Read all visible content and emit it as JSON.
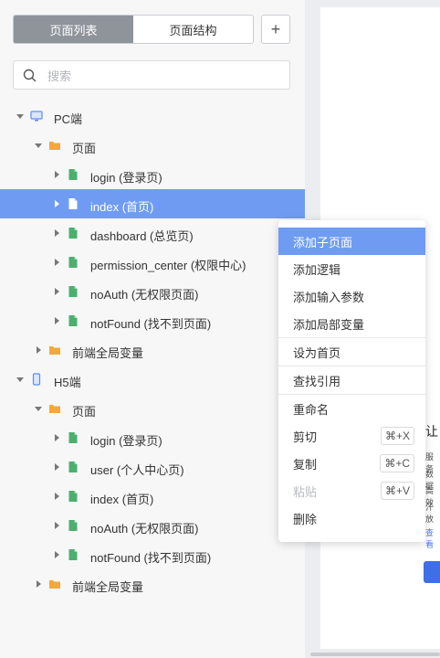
{
  "tabs": {
    "page_list": "页面列表",
    "page_structure": "页面结构"
  },
  "add_button": "+",
  "search": {
    "placeholder": "搜索"
  },
  "tree": [
    {
      "label": "PC端",
      "type": "platform",
      "platform_icon": "monitor-icon"
    },
    {
      "label": "页面",
      "type": "folder"
    },
    {
      "label": "login (登录页)",
      "type": "page"
    },
    {
      "label": "index (首页)",
      "type": "page",
      "selected": true
    },
    {
      "label": "dashboard (总览页)",
      "type": "page"
    },
    {
      "label": "permission_center (权限中心)",
      "type": "page"
    },
    {
      "label": "noAuth (无权限页面)",
      "type": "page"
    },
    {
      "label": "notFound (找不到页面)",
      "type": "page"
    },
    {
      "label": "前端全局变量",
      "type": "folder"
    },
    {
      "label": "H5端",
      "type": "platform",
      "platform_icon": "mobile-icon"
    },
    {
      "label": "页面",
      "type": "folder"
    },
    {
      "label": "login (登录页)",
      "type": "page"
    },
    {
      "label": "user (个人中心页)",
      "type": "page"
    },
    {
      "label": "index (首页)",
      "type": "page"
    },
    {
      "label": "noAuth (无权限页面)",
      "type": "page"
    },
    {
      "label": "notFound (找不到页面)",
      "type": "page"
    },
    {
      "label": "前端全局变量",
      "type": "folder"
    }
  ],
  "context_menu": {
    "add_subpage": "添加子页面",
    "add_logic": "添加逻辑",
    "add_input_param": "添加输入参数",
    "add_local_var": "添加局部变量",
    "set_home": "设为首页",
    "find_refs": "查找引用",
    "rename": "重命名",
    "cut": "剪切",
    "cut_shortcut": "⌘+X",
    "copy": "复制",
    "copy_shortcut": "⌘+C",
    "paste": "粘贴",
    "paste_shortcut": "⌘+V",
    "delete": "删除"
  },
  "canvas": {
    "title_fragment": "让",
    "line1": "服务",
    "line2": "数 据",
    "line3": "高 效",
    "line4": "汗 放",
    "link_fragment": "查看"
  },
  "colors": {
    "accent": "#6f9cf2",
    "page_icon": "#4caf6e",
    "folder_icon": "#f2a93b",
    "platform_icon": "#5b8def"
  }
}
